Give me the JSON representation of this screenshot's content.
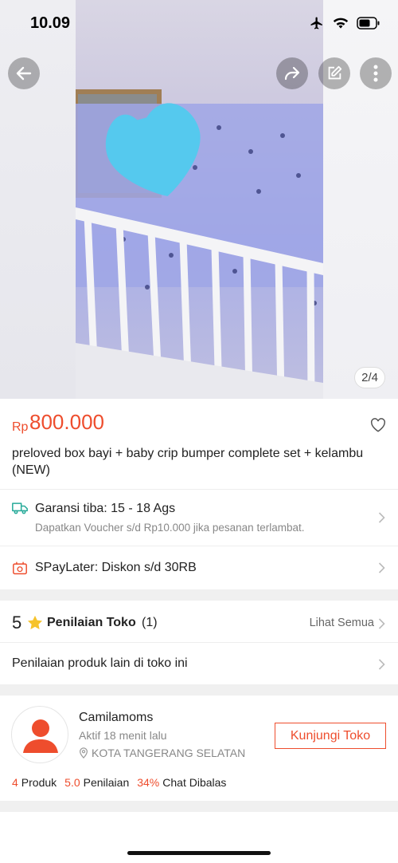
{
  "status": {
    "time": "10.09"
  },
  "gallery": {
    "counter": "2/4"
  },
  "product": {
    "currency": "Rp",
    "price": "800.000",
    "title": "preloved box bayi + baby crip bumper complete set + kelambu (NEW)"
  },
  "shipping": {
    "title": "Garansi tiba: 15 - 18 Ags",
    "subtitle": "Dapatkan Voucher s/d Rp10.000 jika pesanan terlambat."
  },
  "paylater": {
    "title": "SPayLater: Diskon s/d 30RB"
  },
  "reviews": {
    "rating": "5",
    "label": "Penilaian Toko",
    "count": "(1)",
    "see_all": "Lihat Semua",
    "other_products": "Penilaian produk lain di toko ini"
  },
  "shop": {
    "name": "Camilamoms",
    "active": "Aktif 18 menit lalu",
    "location": "KOTA TANGERANG SELATAN",
    "visit_label": "Kunjungi Toko",
    "stats": {
      "products_num": "4",
      "products_label": "Produk",
      "rating_num": "5.0",
      "rating_label": "Penilaian",
      "chat_num": "34%",
      "chat_label": "Chat Dibalas"
    }
  },
  "colors": {
    "accent": "#ee4d2d",
    "teal": "#26aa99"
  }
}
